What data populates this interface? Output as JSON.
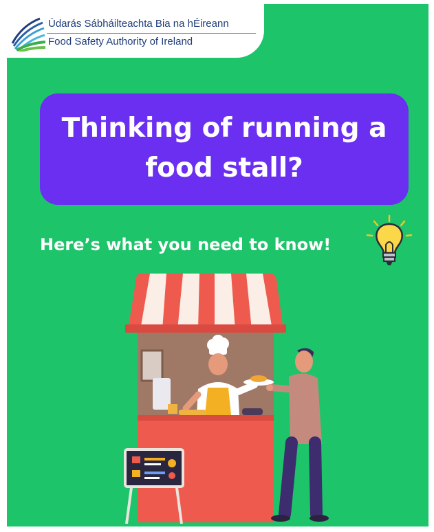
{
  "logo": {
    "name_irish": "Údarás Sábháilteachta Bia na hÉireann",
    "name_english": "Food Safety Authority of Ireland",
    "icon": "fsai-wave-logo-icon"
  },
  "headline": "Thinking of running a food stall?",
  "subheadline": "Here’s what you need to know!",
  "icons": {
    "idea": "lightbulb-icon",
    "illustration": "food-stall-illustration"
  },
  "colors": {
    "background": "#1ec46a",
    "headline_box": "#6a2ff0",
    "awning_red": "#ef5a4f",
    "counter_red": "#ef5a4f",
    "logo_text": "#1f3d7a"
  }
}
